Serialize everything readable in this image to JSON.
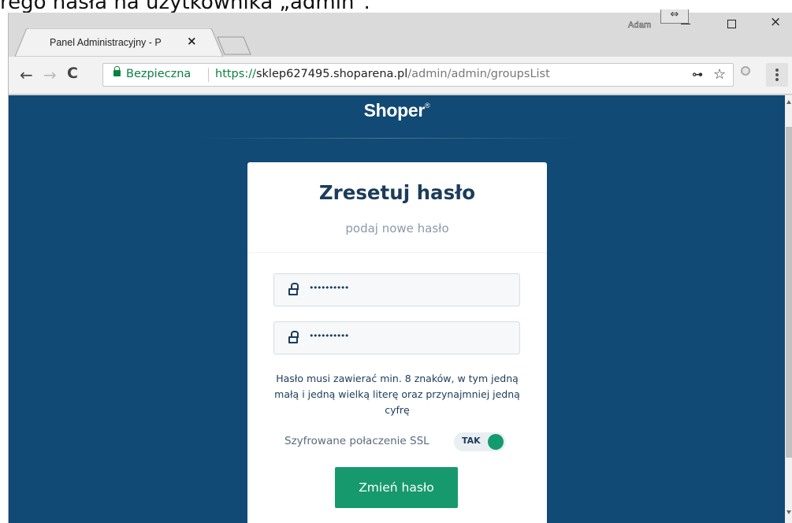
{
  "caption": "rego hasła na użytkownika „admin”.",
  "browser": {
    "tab_title": "Panel Administracyjny - P",
    "tab_title_fade": "",
    "tab_close": "×",
    "user_label": "Adam",
    "resize_glyph": "⇔",
    "close_glyph": "×",
    "secure_label": "Bezpieczna",
    "url_scheme": "https://",
    "url_host": "sklep627495.shoparena.pl",
    "url_path": "/admin/admin/groupsList",
    "back_glyph": "←",
    "forward_glyph": "→",
    "reload_glyph": "C",
    "key_glyph": "⊶",
    "star_glyph": "☆"
  },
  "page": {
    "logo_text": "Shoper",
    "logo_mark": "®",
    "title": "Zresetuj hasło",
    "subtitle": "podaj nowe hasło",
    "password_1": "••••••••••",
    "password_2": "••••••••••",
    "hint": "Hasło musi zawierać min. 8 znaków, w tym jedną małą i jedną wielką literę oraz przynajmniej jedną cyfrę",
    "ssl_label": "Szyfrowane połaczenie SSL",
    "ssl_toggle": "TAK",
    "submit_label": "Zmień hasło"
  },
  "icons": {
    "lock": "lock-icon",
    "key": "key-icon",
    "star": "star-icon"
  },
  "colors": {
    "page_bg": "#114a74",
    "title": "#1c3c5b",
    "accent": "#17996e",
    "secure": "#0b8043"
  }
}
